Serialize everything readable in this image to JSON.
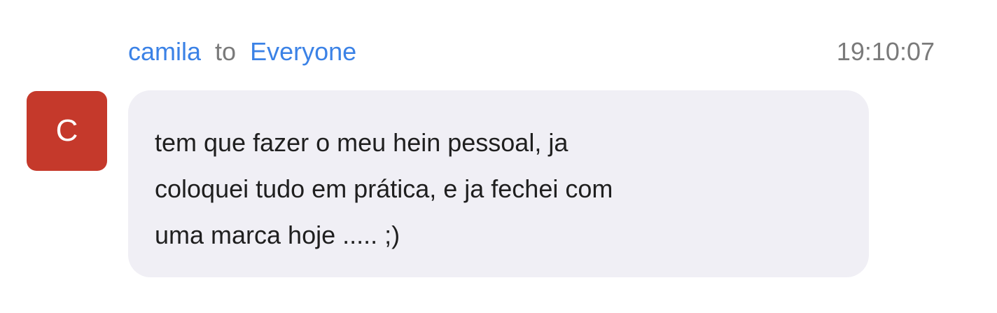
{
  "message": {
    "sender": "camila",
    "to_label": "to",
    "recipient": "Everyone",
    "timestamp": "19:10:07",
    "avatar_initial": "C",
    "text": "tem que fazer o meu hein pessoal, ja\ncoloquei tudo em prática, e ja fechei com\numa marca hoje ..... ;)"
  },
  "colors": {
    "link": "#3b82e6",
    "muted": "#7a7a7a",
    "avatar_bg": "#c5392b",
    "bubble_bg": "#f0eff5"
  }
}
